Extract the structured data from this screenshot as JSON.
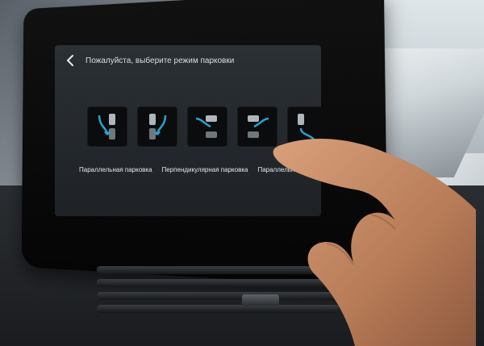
{
  "screen": {
    "back_icon": "chevron-left-icon",
    "title": "Пожалуйста, выберите режим парковки"
  },
  "modes": [
    {
      "label": "Параллельная парковка",
      "tiles": [
        "parallel-left-icon",
        "parallel-right-icon"
      ]
    },
    {
      "label": "Перпендикулярная парковка",
      "tiles": [
        "perpendicular-left-icon",
        "perpendicular-right-icon"
      ]
    },
    {
      "label": "Параллельный выезд",
      "tiles": [
        "exit-parallel-icon"
      ]
    }
  ],
  "colors": {
    "accent": "#2aa3c9",
    "screen_bg": "#23282c",
    "text": "#e6e9eb"
  }
}
